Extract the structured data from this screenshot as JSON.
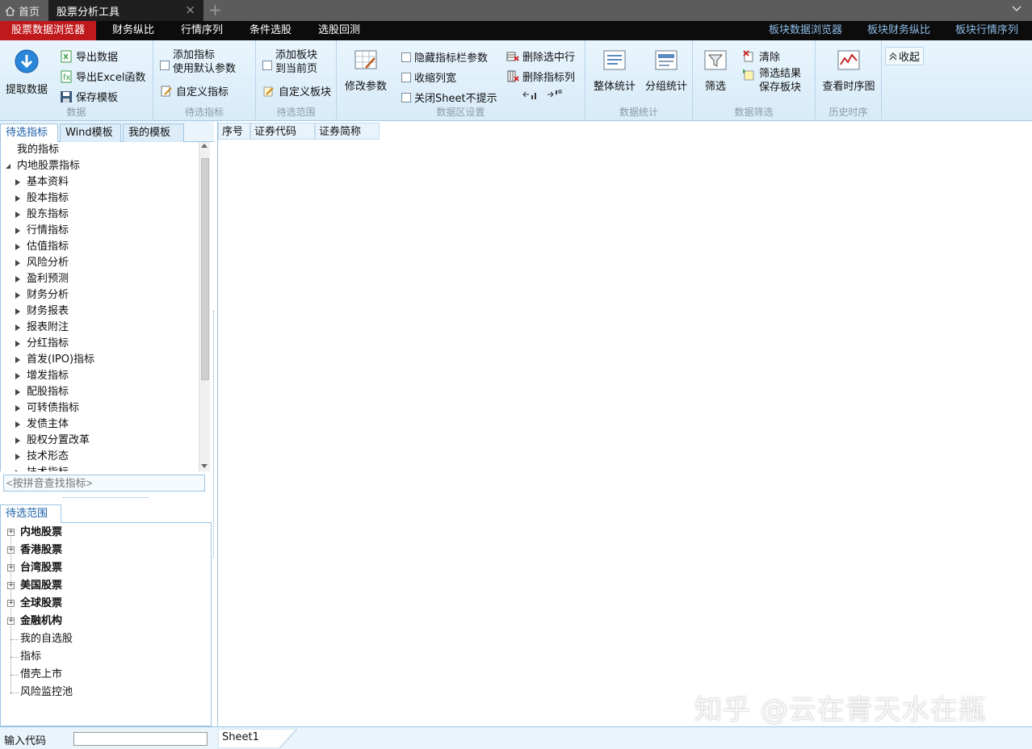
{
  "tabs": {
    "home": "首页",
    "active": "股票分析工具",
    "close": "×",
    "plus": "+",
    "chevron": "⌄"
  },
  "menu": {
    "items": [
      "股票数据浏览器",
      "财务纵比",
      "行情序列",
      "条件选股",
      "选股回测"
    ],
    "right": [
      "板块数据浏览器",
      "板块财务纵比",
      "板块行情序列"
    ]
  },
  "ribbon": {
    "data": {
      "fetch": "提取数据",
      "export_data": "导出数据",
      "export_excel": "导出Excel函数",
      "save_template": "保存模板",
      "label": "数据"
    },
    "indicators": {
      "add": "添加指标",
      "default_params": "使用默认参数",
      "custom": "自定义指标",
      "label": "待选指标"
    },
    "range": {
      "add_board_1": "添加板块",
      "add_board_2": "到当前页",
      "custom_board": "自定义板块",
      "label": "待选范围"
    },
    "settings": {
      "modify": "修改参数",
      "hide_params": "隐藏指标栏参数",
      "shrink_cols": "收缩列宽",
      "close_sheet": "关闭Sheet不提示",
      "del_row": "删除选中行",
      "del_col": "删除指标列",
      "label": "数据区设置"
    },
    "stats": {
      "overall": "整体统计",
      "group": "分组统计",
      "label": "数据统计"
    },
    "filter": {
      "filter": "筛选",
      "clear": "清除",
      "save_1": "筛选结果",
      "save_2": "保存板块",
      "label": "数据筛选"
    },
    "history": {
      "chart": "查看时序图",
      "label": "历史时序"
    },
    "collapse": "收起"
  },
  "left": {
    "tabs": [
      "待选指标",
      "Wind模板",
      "我的模板"
    ],
    "tree": {
      "my": "我的指标",
      "root": "内地股票指标",
      "items": [
        "基本资料",
        "股本指标",
        "股东指标",
        "行情指标",
        "估值指标",
        "风险分析",
        "盈利预测",
        "财务分析",
        "财务报表",
        "报表附注",
        "分红指标",
        "首发(IPO)指标",
        "增发指标",
        "配股指标",
        "可转债指标",
        "发债主体",
        "股权分置改革",
        "技术形态",
        "技术指标"
      ]
    },
    "search_placeholder": "<按拼音查找指标>",
    "range_tab": "待选范围",
    "range_items": [
      {
        "label": "内地股票",
        "bold": true
      },
      {
        "label": "香港股票",
        "bold": true
      },
      {
        "label": "台湾股票",
        "bold": true
      },
      {
        "label": "美国股票",
        "bold": true
      },
      {
        "label": "全球股票",
        "bold": true
      },
      {
        "label": "金融机构",
        "bold": true
      },
      {
        "label": "我的自选股",
        "bold": false
      },
      {
        "label": "指标",
        "bold": false
      },
      {
        "label": "借壳上市",
        "bold": false
      },
      {
        "label": "风险监控池",
        "bold": false
      }
    ]
  },
  "grid": {
    "columns": [
      "序号",
      "证券代码",
      "证券简称"
    ]
  },
  "bottom": {
    "input_label": "输入代码",
    "sheet": "Sheet1"
  },
  "watermark": "知乎 @云在青天水在瓶"
}
